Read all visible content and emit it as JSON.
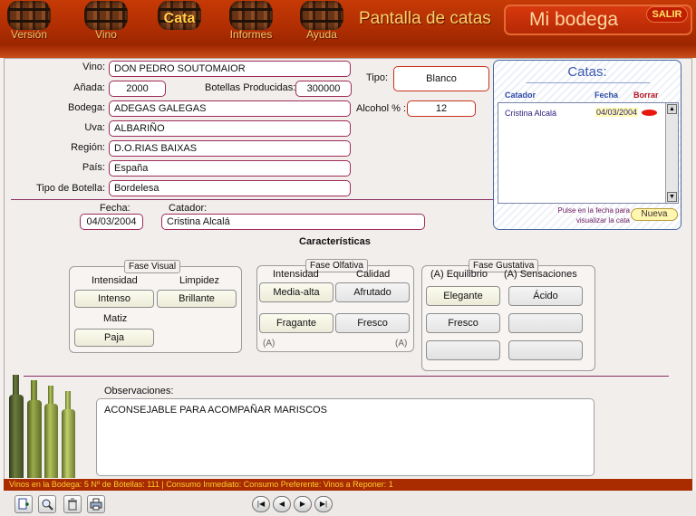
{
  "nav": {
    "items": [
      {
        "label": "Versión",
        "icon": "barrel-icon"
      },
      {
        "label": "Vino",
        "icon": "barrel-icon"
      },
      {
        "label": "Cata",
        "icon": "barrel-icon",
        "active": true
      },
      {
        "label": "Informes",
        "icon": "barrel-icon"
      },
      {
        "label": "Ayuda",
        "icon": "barrel-icon"
      }
    ],
    "screen_title": "Pantalla de catas",
    "brand": "Mi bodega",
    "exit_label": "SALIR"
  },
  "wine": {
    "vino_label": "Vino:",
    "vino": "DON PEDRO SOUTOMAIOR",
    "anada_label": "Añada:",
    "anada": "2000",
    "botellas_label": "Botellas Producidas:",
    "botellas": "300000",
    "bodega_label": "Bodega:",
    "bodega": "ADEGAS GALEGAS",
    "uva_label": "Uva:",
    "uva": "ALBARIÑO",
    "region_label": "Región:",
    "region": "D.O.RIAS BAIXAS",
    "pais_label": "País:",
    "pais": "España",
    "tipo_botella_label": "Tipo de Botella:",
    "tipo_botella": "Bordelesa",
    "tipo_label": "Tipo:",
    "tipo": "Blanco",
    "alcohol_label": "Alcohol % :",
    "alcohol": "12"
  },
  "catas": {
    "title": "Catas:",
    "col_catador": "Catador",
    "col_fecha": "Fecha",
    "col_borrar": "Borrar",
    "rows": [
      {
        "catador": "Cristina Alcalá",
        "fecha": "04/03/2004"
      }
    ],
    "hint": "Pulse en la fecha para visualizar la cata",
    "nueva_label": "Nueva"
  },
  "tasting": {
    "fecha_label": "Fecha:",
    "fecha": "04/03/2004",
    "catador_label": "Catador:",
    "catador": "Cristina Alcalá",
    "caracteristicas": "Características",
    "visual": {
      "title": "Fase Visual",
      "intensidad_label": "Intensidad",
      "intensidad": "Intenso",
      "limpidez_label": "Limpidez",
      "limpidez": "Brillante",
      "matiz_label": "Matiz",
      "matiz": "Paja"
    },
    "olfativa": {
      "title": "Fase Olfativa",
      "intensidad_label": "Intensidad",
      "calidad_label": "Calidad",
      "buttons": [
        "Media-alta",
        "Afrutado",
        "Fragante",
        "Fresco"
      ],
      "a_mark": "(A)"
    },
    "gustativa": {
      "title": "Fase Gustativa",
      "equilibrio_label": "(A) Equilibrio",
      "sensaciones_label": "(A) Sensaciones",
      "buttons": [
        "Elegante",
        "Ácido",
        "Fresco",
        "",
        "",
        ""
      ]
    },
    "observaciones_label": "Observaciones:",
    "observaciones": "ACONSEJABLE PARA ACOMPAÑAR MARISCOS"
  },
  "status": {
    "text": "Vinos en la Bodega: 5    Nº de Bótellas: 111   |    Consumo Inmediato:     Consumo Preferente:     Vinos a Reponer: 1"
  },
  "toolbar": {
    "buttons": [
      "add-record-icon",
      "search-icon",
      "delete-icon",
      "print-icon"
    ],
    "nav": [
      "first-record-icon",
      "previous-record-icon",
      "next-record-icon",
      "last-record-icon"
    ]
  },
  "colors": {
    "topbar": "#b02e02",
    "field_border": "#9f2b5a",
    "catas_title": "#3b58b0"
  }
}
